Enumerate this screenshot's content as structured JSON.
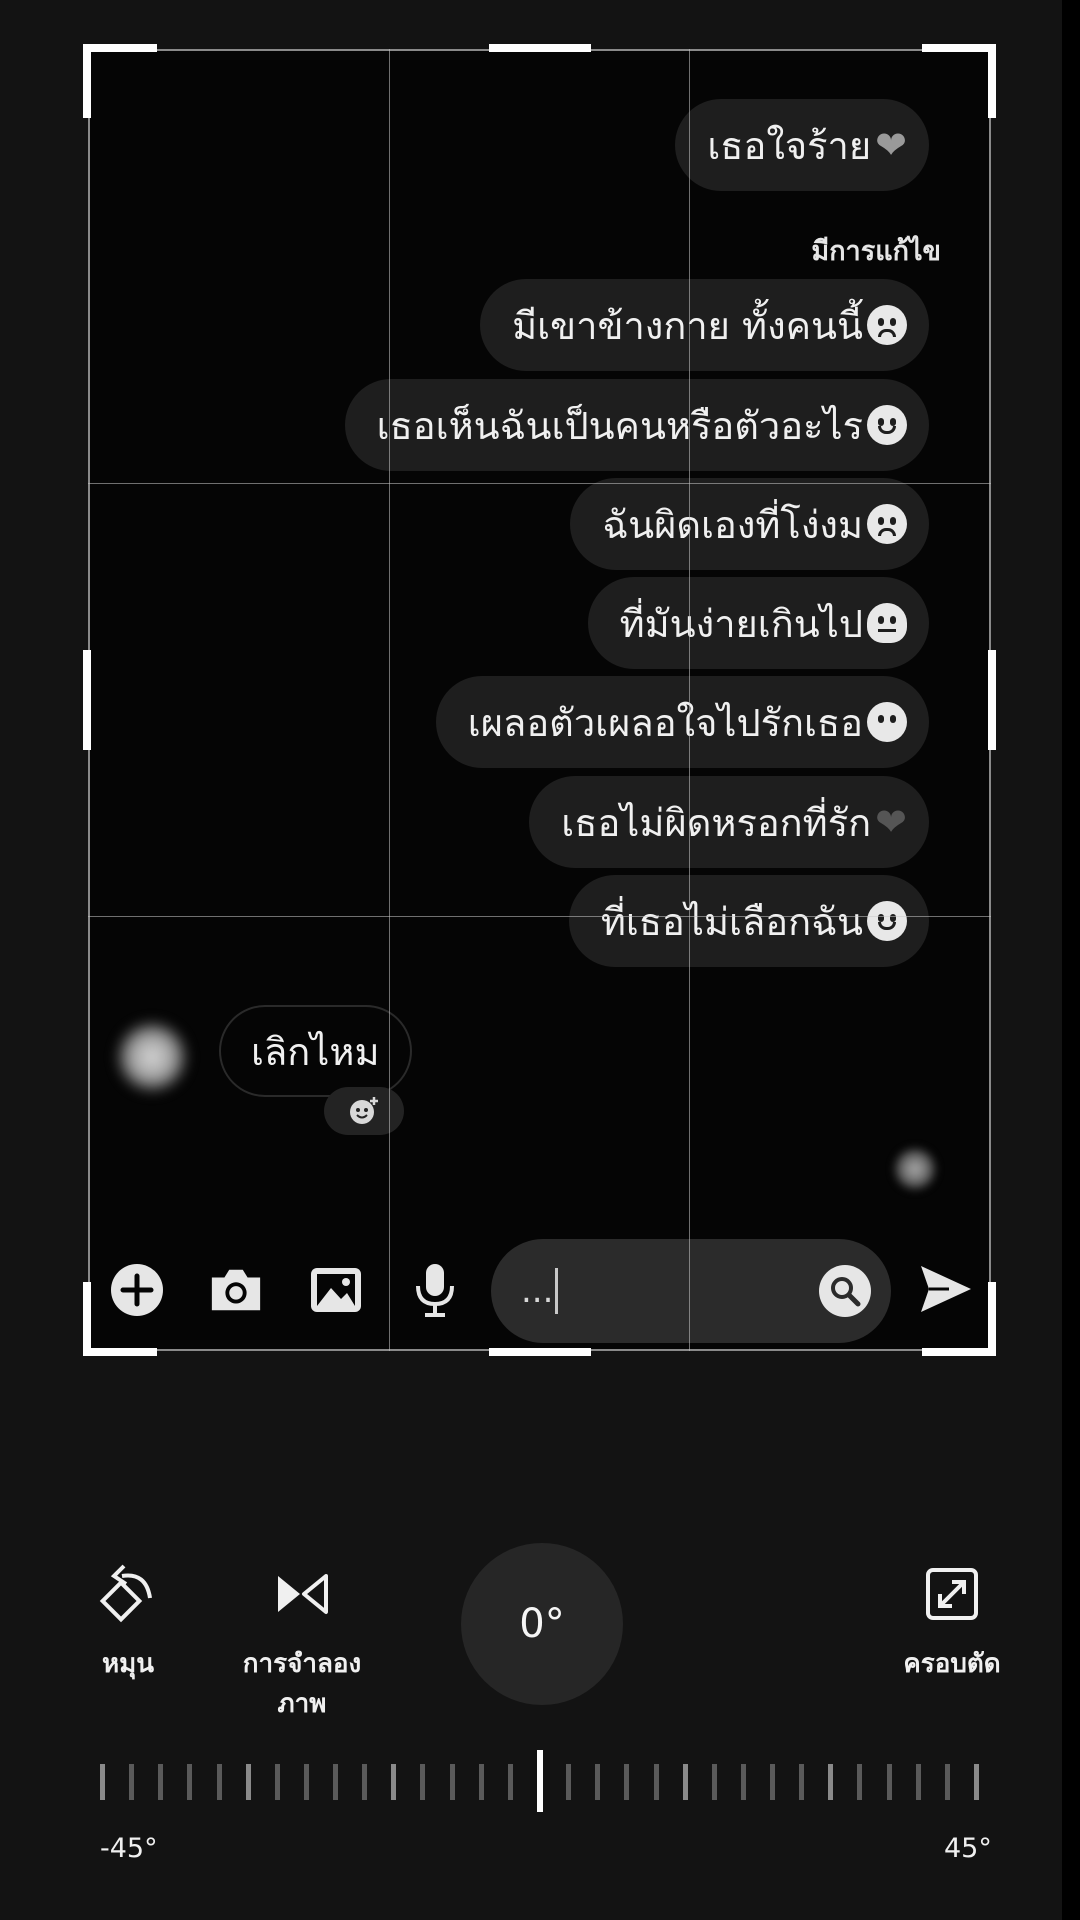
{
  "chat": {
    "outgoing_messages": [
      {
        "text": "เธอใจร้าย",
        "emoji": "broken-heart"
      },
      {
        "text": "มีเขาข้างกาย  ทั้งคนนี้",
        "emoji": "upside-down-face"
      },
      {
        "text": "เธอเห็นฉันเป็นคนหรือตัวอะไร",
        "emoji": "slight-smile"
      },
      {
        "text": "ฉันผิดเองที่โง่งม",
        "emoji": "upside-down-face"
      },
      {
        "text": "ที่มันง่ายเกินไป",
        "emoji": "melting-face"
      },
      {
        "text": "เผลอตัวเผลอใจไปรักเธอ",
        "emoji": "no-mouth-face"
      },
      {
        "text": "เธอไม่ผิดหรอกที่รัก",
        "emoji": "black-heart"
      },
      {
        "text": "ที่เธอไม่เลือกฉัน",
        "emoji": "slight-smile"
      }
    ],
    "edited_label": "มีการแก้ไข",
    "incoming_message": {
      "text": "เลิกไหม"
    },
    "composer": {
      "input_value": "..."
    }
  },
  "toolbar": {
    "rotate_label": "หมุน",
    "mirror_label_line1": "การจำลอง",
    "mirror_label_line2": "ภาพ",
    "crop_label": "ครอบตัด",
    "angle_value": "0°",
    "angle_min_label": "-45°",
    "angle_max_label": "45°",
    "angle_current": 0
  },
  "icons": [
    "plus-circle-icon",
    "camera-icon",
    "image-icon",
    "mic-icon",
    "search-icon",
    "send-icon",
    "rotate-icon",
    "mirror-icon",
    "crop-expand-icon"
  ]
}
